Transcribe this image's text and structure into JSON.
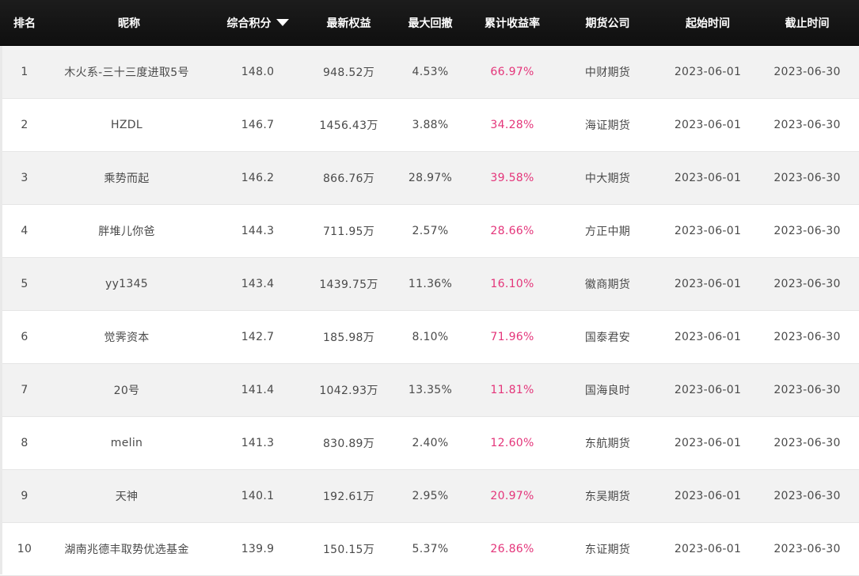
{
  "header": {
    "rank": "排名",
    "name": "昵称",
    "score": "综合积分",
    "equity": "最新权益",
    "drawdown": "最大回撤",
    "return": "累计收益率",
    "company": "期货公司",
    "start": "起始时间",
    "end": "截止时间",
    "sort_icon": "triangle-down-icon"
  },
  "colors": {
    "header_bg": "#141414",
    "return_text": "#e4357a",
    "row_alt": "#f2f2f2"
  },
  "rows": [
    {
      "rank": "1",
      "name": "木火系-三十三度进取5号",
      "score": "148.0",
      "equity": "948.52万",
      "drawdown": "4.53%",
      "return": "66.97%",
      "company": "中财期货",
      "start": "2023-06-01",
      "end": "2023-06-30"
    },
    {
      "rank": "2",
      "name": "HZDL",
      "score": "146.7",
      "equity": "1456.43万",
      "drawdown": "3.88%",
      "return": "34.28%",
      "company": "海证期货",
      "start": "2023-06-01",
      "end": "2023-06-30"
    },
    {
      "rank": "3",
      "name": "乘势而起",
      "score": "146.2",
      "equity": "866.76万",
      "drawdown": "28.97%",
      "return": "39.58%",
      "company": "中大期货",
      "start": "2023-06-01",
      "end": "2023-06-30"
    },
    {
      "rank": "4",
      "name": "胖堆儿你爸",
      "score": "144.3",
      "equity": "711.95万",
      "drawdown": "2.57%",
      "return": "28.66%",
      "company": "方正中期",
      "start": "2023-06-01",
      "end": "2023-06-30"
    },
    {
      "rank": "5",
      "name": "yy1345",
      "score": "143.4",
      "equity": "1439.75万",
      "drawdown": "11.36%",
      "return": "16.10%",
      "company": "徽商期货",
      "start": "2023-06-01",
      "end": "2023-06-30"
    },
    {
      "rank": "6",
      "name": "觉霁资本",
      "score": "142.7",
      "equity": "185.98万",
      "drawdown": "8.10%",
      "return": "71.96%",
      "company": "国泰君安",
      "start": "2023-06-01",
      "end": "2023-06-30"
    },
    {
      "rank": "7",
      "name": "20号",
      "score": "141.4",
      "equity": "1042.93万",
      "drawdown": "13.35%",
      "return": "11.81%",
      "company": "国海良时",
      "start": "2023-06-01",
      "end": "2023-06-30"
    },
    {
      "rank": "8",
      "name": "melin",
      "score": "141.3",
      "equity": "830.89万",
      "drawdown": "2.40%",
      "return": "12.60%",
      "company": "东航期货",
      "start": "2023-06-01",
      "end": "2023-06-30"
    },
    {
      "rank": "9",
      "name": "天神",
      "score": "140.1",
      "equity": "192.61万",
      "drawdown": "2.95%",
      "return": "20.97%",
      "company": "东吴期货",
      "start": "2023-06-01",
      "end": "2023-06-30"
    },
    {
      "rank": "10",
      "name": "湖南兆德丰取势优选基金",
      "score": "139.9",
      "equity": "150.15万",
      "drawdown": "5.37%",
      "return": "26.86%",
      "company": "东证期货",
      "start": "2023-06-01",
      "end": "2023-06-30"
    }
  ]
}
